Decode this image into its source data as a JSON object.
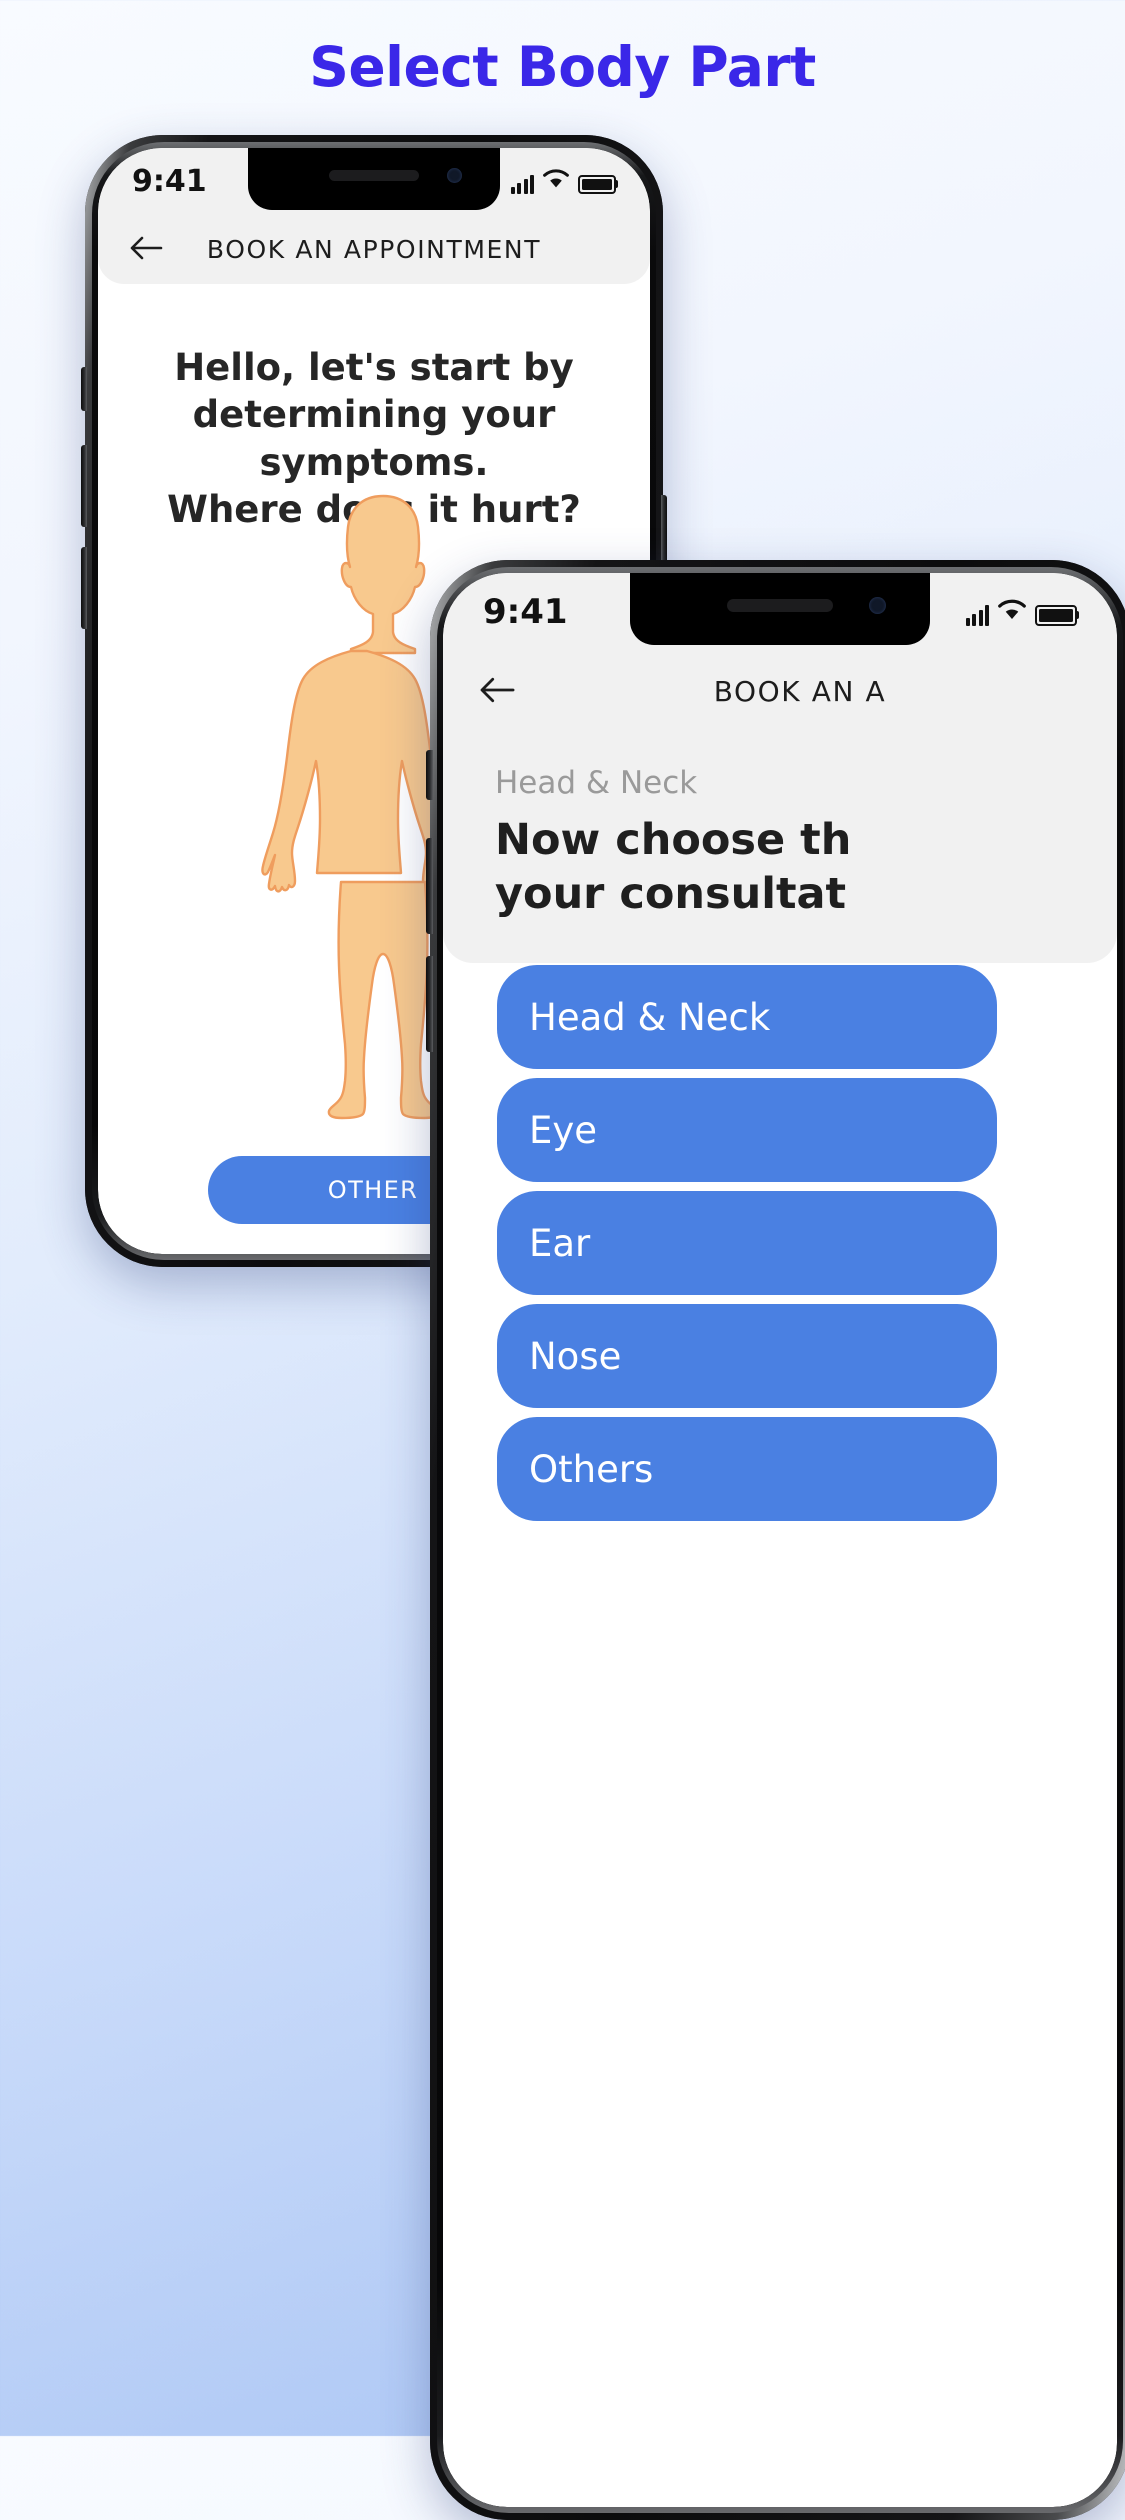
{
  "page": {
    "title": "Select Body Part",
    "title_color": "#3a27e8",
    "background_top": "#f8fbff",
    "background_bottom": "#aac5f4"
  },
  "phone1": {
    "status_bar": {
      "time": "9:41",
      "signal_icon": "cellular-bars-icon",
      "wifi_icon": "wifi-icon",
      "battery_icon": "battery-full-icon"
    },
    "nav": {
      "back_icon": "arrow-left-icon",
      "title": "BOOK AN APPOINTMENT"
    },
    "heading_line1": "Hello, let's start by",
    "heading_line2": "determining your symptoms.",
    "heading_line3": "Where does it hurt?",
    "body_figure": {
      "name": "human-body-silhouette",
      "fill": "#f8c98e",
      "stroke": "#ef9d5e"
    },
    "primary_button": {
      "label": "OTHER",
      "color": "#4a80e2"
    }
  },
  "phone2": {
    "status_bar": {
      "time": "9:41"
    },
    "nav": {
      "back_icon": "arrow-left-icon",
      "title": "BOOK AN A"
    },
    "card": {
      "kicker": "Head & Neck",
      "title_line1": "Now choose th",
      "title_line2": "your consultat"
    },
    "options": [
      {
        "label": "Head & Neck",
        "color": "#4a80e2"
      },
      {
        "label": "Eye",
        "color": "#4a80e2"
      },
      {
        "label": "Ear",
        "color": "#4a80e2"
      },
      {
        "label": "Nose",
        "color": "#4a80e2"
      },
      {
        "label": "Others",
        "color": "#4a80e2"
      }
    ]
  }
}
